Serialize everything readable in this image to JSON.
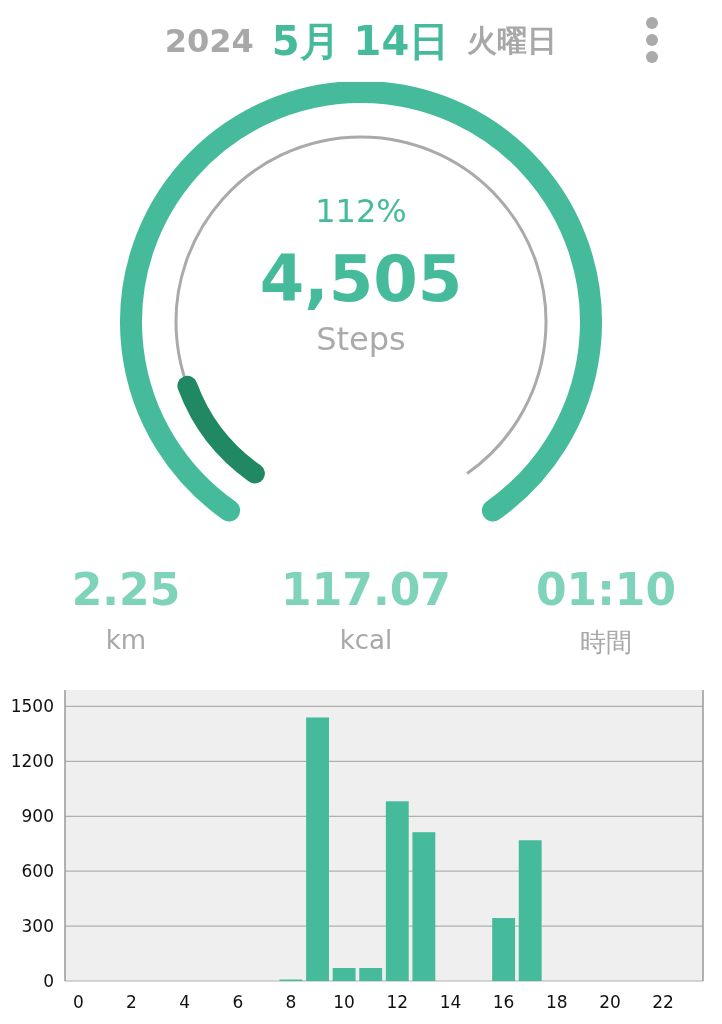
{
  "header": {
    "year": "2024",
    "date": "5月 14日",
    "weekday": "火曜日"
  },
  "gauge": {
    "percent": "112%",
    "steps": "4,505",
    "unit": "Steps",
    "overflow_ring": {
      "level": 0.12
    }
  },
  "stats": [
    {
      "value": "2.25",
      "label": "km"
    },
    {
      "value": "117.07",
      "label": "kcal"
    },
    {
      "value": "01:10",
      "label": "時間"
    }
  ],
  "chart_data": {
    "type": "bar",
    "x": [
      0,
      1,
      2,
      3,
      4,
      5,
      6,
      7,
      8,
      9,
      10,
      11,
      12,
      13,
      14,
      15,
      16,
      17,
      18,
      19,
      20,
      21,
      22,
      23
    ],
    "grid": true,
    "values": [
      0,
      0,
      0,
      0,
      0,
      0,
      0,
      0,
      8,
      1440,
      71,
      71,
      982,
      813,
      0,
      0,
      344,
      769,
      0,
      0,
      0,
      0,
      0,
      0
    ],
    "xlim": [
      -0.5,
      23.5
    ],
    "ylim": [
      0,
      1590
    ],
    "xticks": [
      0,
      2,
      4,
      6,
      8,
      10,
      12,
      14,
      16,
      18,
      20,
      22
    ],
    "yticks": [
      0,
      300,
      600,
      900,
      1200,
      1500
    ]
  }
}
